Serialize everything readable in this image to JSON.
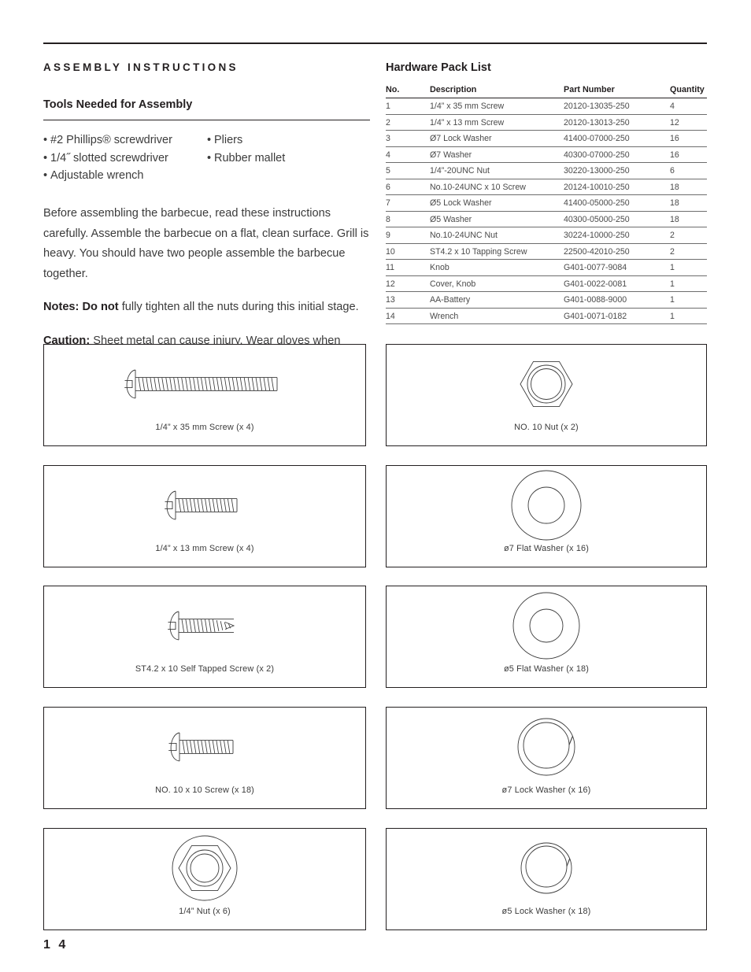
{
  "document": {
    "page_number": "1 4"
  },
  "left": {
    "kicker": "ASSEMBLY INSTRUCTIONS",
    "tools_heading": "Tools Needed for Assembly",
    "tools_col1": [
      "#2 Phillips® screwdriver",
      "1/4˝ slotted screwdriver",
      "Adjustable wrench"
    ],
    "tools_col2": [
      "Pliers",
      "Rubber mallet"
    ],
    "intro_paragraph": "Before assembling the barbecue, read these instructions carefully. Assemble the barbecue on a flat, clean surface. Grill is heavy. You should have two people assemble the barbecue together.",
    "notes_label": "Notes: Do not",
    "notes_text": " fully tighten all the nuts during this initial stage.",
    "caution_label": "Caution:",
    "caution_text": " Sheet metal can cause injury. Wear gloves when installing the grill. Use care when assembling."
  },
  "hardware_table": {
    "title": "Hardware Pack List",
    "columns": [
      "No.",
      "Description",
      "Part Number",
      "Quantity"
    ],
    "rows": [
      {
        "no": "1",
        "description": "1/4” x 35 mm Screw",
        "part": "20120-13035-250",
        "qty": "4"
      },
      {
        "no": "2",
        "description": "1/4” x 13 mm Screw",
        "part": "20120-13013-250",
        "qty": "12"
      },
      {
        "no": "3",
        "description": "Ø7 Lock Washer",
        "part": "41400-07000-250",
        "qty": "16"
      },
      {
        "no": "4",
        "description": "Ø7 Washer",
        "part": "40300-07000-250",
        "qty": "16"
      },
      {
        "no": "5",
        "description": "1/4”-20UNC Nut",
        "part": "30220-13000-250",
        "qty": "6"
      },
      {
        "no": "6",
        "description": "No.10-24UNC x 10 Screw",
        "part": "20124-10010-250",
        "qty": "18"
      },
      {
        "no": "7",
        "description": "Ø5 Lock Washer",
        "part": "41400-05000-250",
        "qty": "18"
      },
      {
        "no": "8",
        "description": "Ø5 Washer",
        "part": "40300-05000-250",
        "qty": "18"
      },
      {
        "no": "9",
        "description": "No.10-24UNC Nut",
        "part": "30224-10000-250",
        "qty": "2"
      },
      {
        "no": "10",
        "description": "ST4.2 x 10 Tapping Screw",
        "part": "22500-42010-250",
        "qty": "2"
      },
      {
        "no": "11",
        "description": "Knob",
        "part": "G401-0077-9084",
        "qty": "1"
      },
      {
        "no": "12",
        "description": "Cover, Knob",
        "part": "G401-0022-0081",
        "qty": "1"
      },
      {
        "no": "13",
        "description": "AA-Battery",
        "part": "G401-0088-9000",
        "qty": "1"
      },
      {
        "no": "14",
        "description": "Wrench",
        "part": "G401-0071-0182",
        "qty": "1"
      }
    ]
  },
  "hardware_boxes": {
    "left_column": [
      {
        "icon": "pan-head-screw-long-icon",
        "caption": "1/4” x 35 mm Screw (x 4)"
      },
      {
        "icon": "pan-head-screw-short-icon",
        "caption": "1/4” x 13 mm Screw (x 4)"
      },
      {
        "icon": "self-tapping-screw-icon",
        "caption": "ST4.2 x 10 Self Tapped Screw (x 2)"
      },
      {
        "icon": "pan-head-screw-medium-icon",
        "caption": "NO. 10 x 10 Screw (x 18)"
      },
      {
        "icon": "hex-nut-flanged-icon",
        "caption": "1/4” Nut (x 6)"
      }
    ],
    "right_column": [
      {
        "icon": "hex-nut-icon",
        "caption": "NO. 10 Nut (x 2)"
      },
      {
        "icon": "flat-washer-large-icon",
        "caption": "ø7 Flat Washer (x 16)"
      },
      {
        "icon": "flat-washer-small-icon",
        "caption": "ø5 Flat Washer (x 18)"
      },
      {
        "icon": "lock-washer-large-icon",
        "caption": "ø7 Lock Washer (x 16)"
      },
      {
        "icon": "lock-washer-small-icon",
        "caption": "ø5 Lock Washer (x 18)"
      }
    ]
  },
  "colors": {
    "ink": "#231f20",
    "body_text": "#3b3b3b",
    "line": "#6d6d6d"
  }
}
